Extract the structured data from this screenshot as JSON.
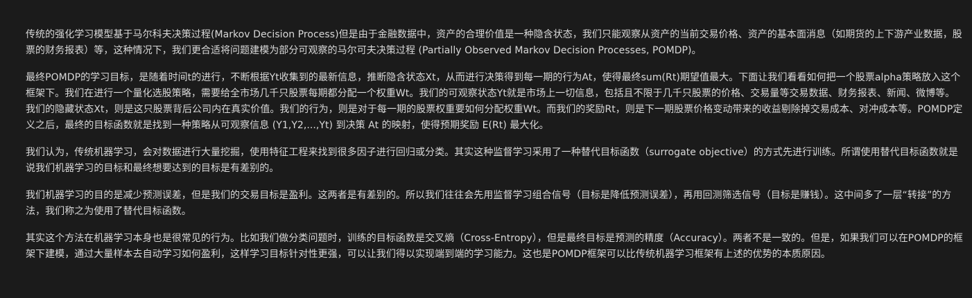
{
  "article": {
    "paragraphs": [
      "传统的强化学习模型基于马尔科夫决策过程(Markov Decision Process)但是由于金融数据中，资产的合理价值是一种隐含状态，我们只能观察从资产的当前交易价格、资产的基本面消息（如期货的上下游产业数据，股票的财务报表）等，这种情况下，我们更合适将问题建模为部分可观察的马尔可夫决策过程 (Partially Observed Markov Decision Processes, POMDP)。",
      "最终POMDP的学习目标，是随着时间t的进行，不断根据Yt收集到的最新信息，推断隐含状态Xt，从而进行决策得到每一期的行为At，使得最终sum(Rt)期望值最大。下面让我们看看如何把一个股票alpha策略放入这个框架下。我们在进行一个量化选股策略，需要给全市场几千只股票每期都分配一个权重Wt。我们的可观察状态Yt就是市场上一切信息，包括且不限于几千只股票的价格、交易量等交易数据、财务报表、新闻、微博等。我们的隐藏状态Xt，则是这只股票背后公司内在真实价值。我们的行为，则是对于每一期的股票权重要如何分配权重Wt。而我们的奖励Rt，则是下一期股票价格变动带来的收益剔除掉交易成本、对冲成本等。POMDP定义之后，最终的目标函数就是找到一种策略从可观察信息 (Y1,Y2,...,Yt) 到决策 At 的映射，使得预期奖励 E(Rt) 最大化。",
      "我们认为，传统机器学习，会对数据进行大量挖掘，使用特征工程来找到很多因子进行回归或分类。其实这种监督学习采用了一种替代目标函数（surrogate objective）的方式先进行训练。所谓使用替代目标函数就是说我们机器学习的目标和最终想要达到的目标是有差别的。",
      "我们机器学习的目的是减少预测误差，但是我们的交易目标是盈利。这两者是有差别的。所以我们往往会先用监督学习组合信号（目标是降低预测误差），再用回测筛选信号（目标是赚钱）。这中间多了一层“转接”的方法，我们称之为使用了替代目标函数。",
      "其实这个方法在机器学习本身也是很常见的行为。比如我们做分类问题时，训练的目标函数是交叉熵（Cross-Entropy），但是最终目标是预测的精度（Accuracy）。两者不是一致的。但是，如果我们可以在POMDP的框架下建模，通过大量样本去自动学习如何盈利，这样学习目标针对性更强，可以让我们得以实现端到端的学习能力。这也是POMDP框架可以比传统机器学习框架有上述的优势的本质原因。"
    ]
  }
}
